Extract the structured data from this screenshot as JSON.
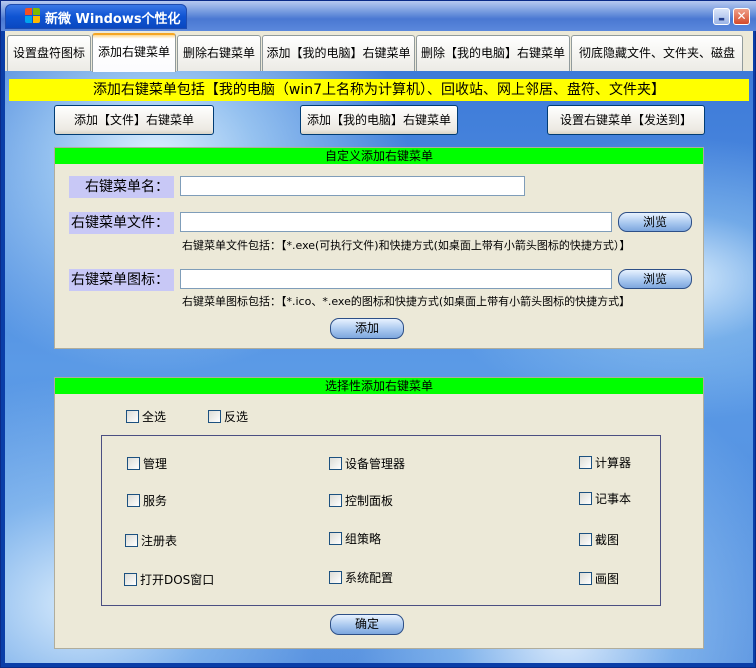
{
  "window": {
    "title": "新微  Windows个性化",
    "minimize_glyph": "▬",
    "close_glyph": "✕",
    "icon": "windows-flag-icon",
    "colors": {
      "titlebar": "#0f54d3",
      "accent_tab": "#f5a623",
      "banner": "#ffff00",
      "group_header": "#00ff00",
      "label_bg": "#c8c8f6"
    }
  },
  "tabs": [
    {
      "label": "设置盘符图标"
    },
    {
      "label": "添加右键菜单",
      "active": true
    },
    {
      "label": "删除右键菜单"
    },
    {
      "label": "添加【我的电脑】右键菜单"
    },
    {
      "label": "删除【我的电脑】右键菜单"
    },
    {
      "label": "彻底隐藏文件、文件夹、磁盘"
    }
  ],
  "banner": {
    "text": "添加右键菜单包括【我的电脑（win7上名称为计算机）、回收站、网上邻居、盘符、文件夹】"
  },
  "top_buttons": {
    "file_menu": "添加【文件】右键菜单",
    "computer_menu": "添加【我的电脑】右键菜单",
    "sendto_menu": "设置右键菜单【发送到】"
  },
  "custom_group": {
    "title": "自定义添加右键菜单",
    "name_label": "右键菜单名：",
    "name_value": "",
    "file_label": "右键菜单文件：",
    "file_value": "",
    "file_browse": "浏览",
    "file_hint": "右键菜单文件包括：【*.exe(可执行文件)和快捷方式(如桌面上带有小箭头图标的快捷方式）】",
    "icon_label": "右键菜单图标：",
    "icon_value": "",
    "icon_browse": "浏览",
    "icon_hint": "右键菜单图标包括：【*.ico、*.exe的图标和快捷方式(如桌面上带有小箭头图标的快捷方式】",
    "add_button": "添加"
  },
  "select_group": {
    "title": "选择性添加右键菜单",
    "select_all": "全选",
    "invert": "反选",
    "items": [
      {
        "label": "管理"
      },
      {
        "label": "设备管理器"
      },
      {
        "label": "计算器"
      },
      {
        "label": "服务"
      },
      {
        "label": "控制面板"
      },
      {
        "label": "记事本"
      },
      {
        "label": "注册表"
      },
      {
        "label": "组策略"
      },
      {
        "label": "截图"
      },
      {
        "label": "打开DOS窗口"
      },
      {
        "label": "系统配置"
      },
      {
        "label": "画图"
      }
    ],
    "confirm_button": "确定"
  }
}
